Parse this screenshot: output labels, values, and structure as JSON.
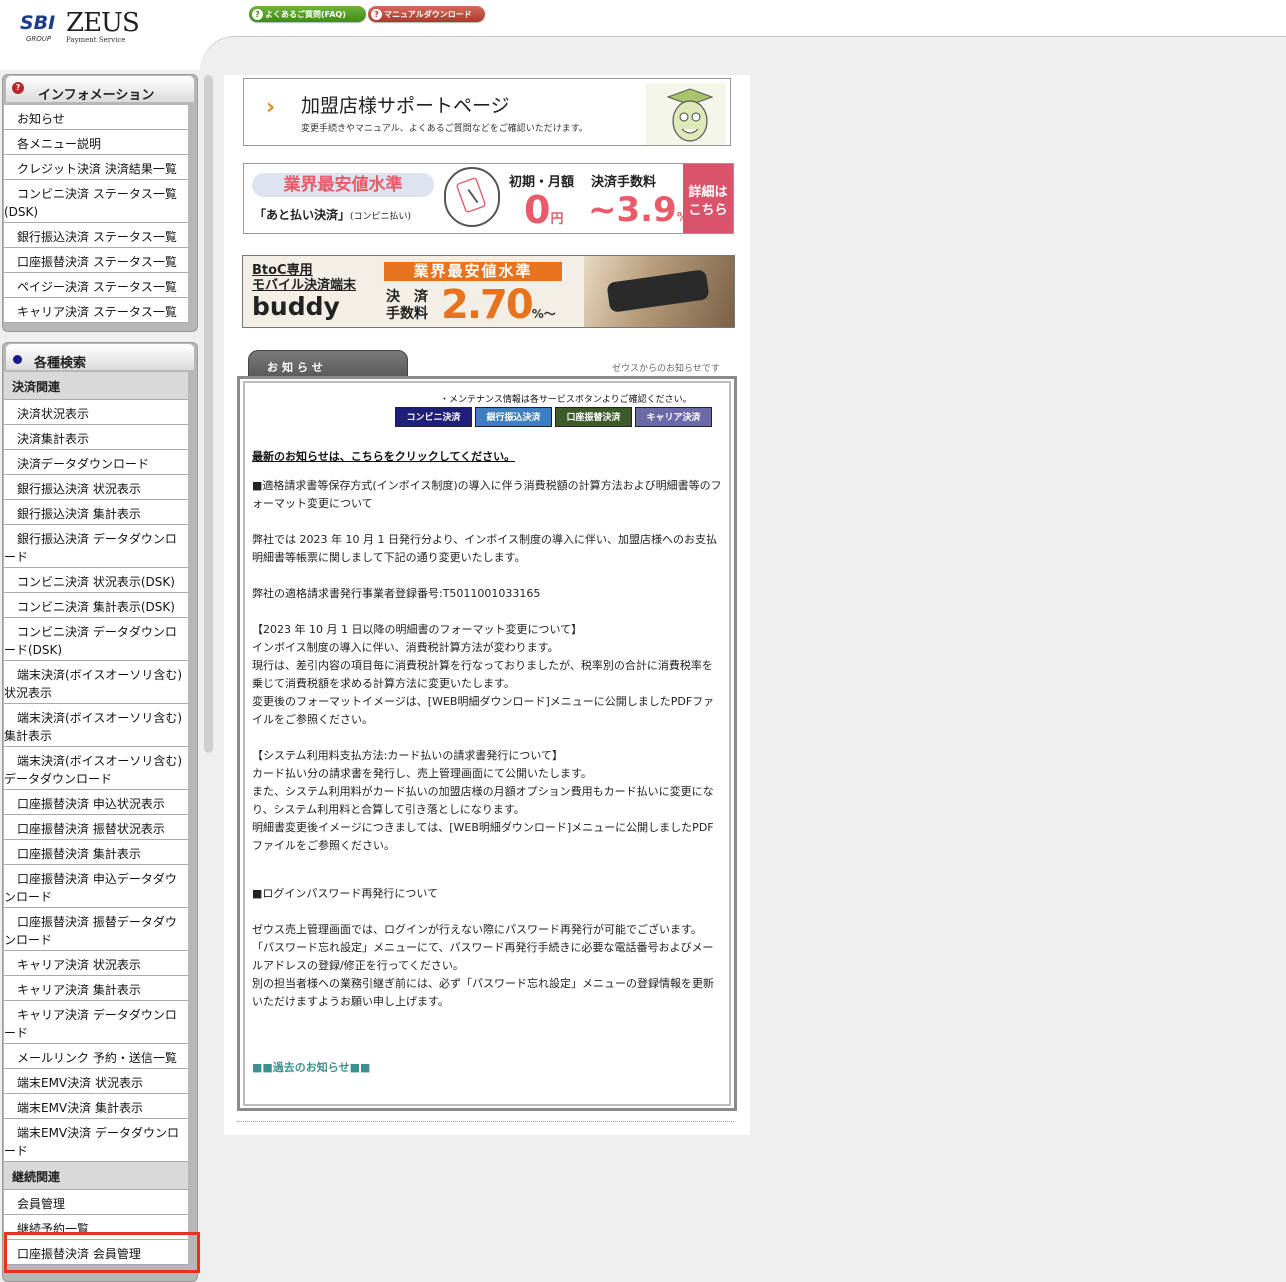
{
  "header": {
    "logo_sbi": "SBI",
    "logo_group": "GROUP",
    "logo_zeus": "ZEUS",
    "logo_ps": "Payment Service",
    "faq_button": "よくあるご質問(FAQ)",
    "manual_button": "マニュアルダウンロード",
    "q_glyph": "?"
  },
  "sidebar": {
    "info_title": "インフォメーション",
    "info_items": [
      "お知らせ",
      "各メニュー説明",
      "クレジット決済 決済結果一覧",
      "コンビニ決済 ステータス一覧(DSK)",
      "銀行振込決済 ステータス一覧",
      "口座振替決済 ステータス一覧",
      "ペイジー決済 ステータス一覧",
      "キャリア決済 ステータス一覧"
    ],
    "search_title": "各種検索",
    "section1": "決済関連",
    "search_items": [
      "決済状況表示",
      "決済集計表示",
      "決済データダウンロード",
      "銀行振込決済 状況表示",
      "銀行振込決済 集計表示",
      "銀行振込決済 データダウンロード",
      "コンビニ決済 状況表示(DSK)",
      "コンビニ決済 集計表示(DSK)",
      "コンビニ決済 データダウンロード(DSK)",
      "端末決済(ボイスオーソリ含む)状況表示",
      "端末決済(ボイスオーソリ含む)集計表示",
      "端末決済(ボイスオーソリ含む)データダウンロード",
      "口座振替決済 申込状況表示",
      "口座振替決済 振替状況表示",
      "口座振替決済 集計表示",
      "口座振替決済 申込データダウンロード",
      "口座振替決済 振替データダウンロード",
      "キャリア決済 状況表示",
      "キャリア決済 集計表示",
      "キャリア決済 データダウンロード",
      "メールリンク 予約・送信一覧",
      "端末EMV決済 状況表示",
      "端末EMV決済 集計表示",
      "端末EMV決済 データダウンロード"
    ],
    "section2": "継続関連",
    "continuous_items": [
      "会員管理",
      "継続予約一覧",
      "口座振替決済 会員管理"
    ]
  },
  "banners": {
    "support_title": "加盟店様サポートページ",
    "support_sub": "変更手続きやマニュアル、よくあるご質問などをご確認いただけます。",
    "chevron": "›",
    "b2_top": "業界最安値水準",
    "b2_sub_main": "「あと払い決済」",
    "b2_sub_small": "(コンビニ払い)",
    "b2_label1": "初期・月額",
    "b2_label2": "決済手数料",
    "b2_value1": "0",
    "b2_unit1": "円",
    "b2_value2": "~3.9",
    "b2_unit2": "%",
    "b2_button_l1": "詳細は",
    "b2_button_l2": "こちら",
    "b3_line1": "BtoC専用",
    "b3_line2": "モバイル決済端末",
    "b3_name": "buddy",
    "b3_badge": "業界最安値水準",
    "b3_label_l1": "決　済",
    "b3_label_l2": "手数料",
    "b3_value": "2.70",
    "b3_unit": "%～"
  },
  "notice": {
    "tab_label": "お知らせ",
    "tab_note": "ゼウスからのお知らせです",
    "maintenance": "・メンテナンス情報は各サービスボタンよりご確認ください。",
    "services": [
      "コンビニ決済",
      "銀行振込決済",
      "口座振替決済",
      "キャリア決済"
    ],
    "latest_link": "最新のお知らせは、こちらをクリックしてください。",
    "p1": "■適格請求書等保存方式(インボイス制度)の導入に伴う消費税額の計算方法および明細書等のフォーマット変更について",
    "p2": "弊社では 2023 年 10 月 1 日発行分より、インボイス制度の導入に伴い、加盟店様へのお支払明細書等帳票に関しまして下記の通り変更いたします。",
    "p3": "弊社の適格請求書発行事業者登録番号:T5011001033165",
    "p4": "【2023 年 10 月 1 日以降の明細書のフォーマット変更について】\nインボイス制度の導入に伴い、消費税計算方法が変わります。\n現行は、差引内容の項目毎に消費税計算を行なっておりましたが、税率別の合計に消費税率を乗じて消費税額を求める計算方法に変更いたします。\n変更後のフォーマットイメージは、[WEB明細ダウンロード]メニューに公開しましたPDFファイルをご参照ください。",
    "p5": "【システム利用料支払方法:カード払いの請求書発行について】\nカード払い分の請求書を発行し、売上管理画面にて公開いたします。\nまた、システム利用料がカード払いの加盟店様の月額オプション費用もカード払いに変更になり、システム利用料と合算して引き落としになります。\n明細書変更後イメージにつきましては、[WEB明細ダウンロード]メニューに公開しましたPDFファイルをご参照ください。",
    "p6": "■ログインパスワード再発行について",
    "p7": "ゼウス売上管理画面では、ログインが行えない際にパスワード再発行が可能でございます。\n「パスワード忘れ設定」メニューにて、パスワード再発行手続きに必要な電話番号およびメールアドレスの登録/修正を行ってください。\n別の担当者様への業務引継ぎ前には、必ず「パスワード忘れ設定」メニューの登録情報を更新いただけますようお願い申し上げます。",
    "past_link": "■■過去のお知らせ■■"
  }
}
